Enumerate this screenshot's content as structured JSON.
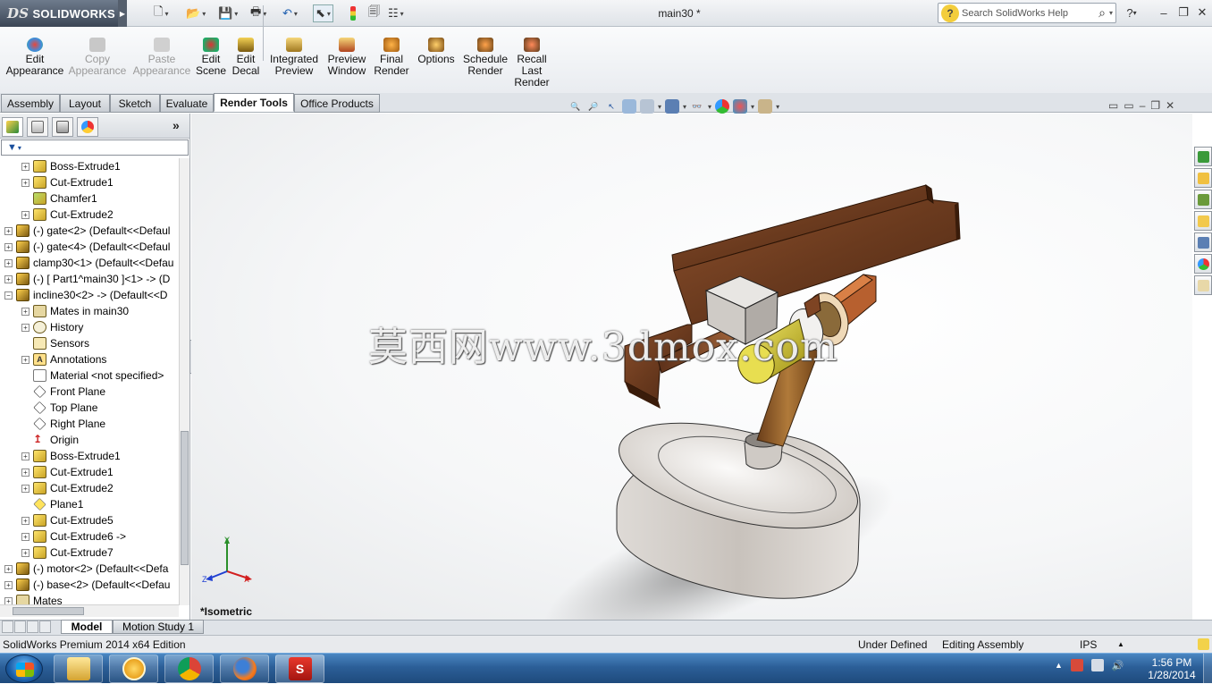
{
  "app": {
    "brand": "SOLIDWORKS",
    "brand_prefix": "DS",
    "document_title": "main30 *"
  },
  "quick_access": [
    {
      "name": "new-icon"
    },
    {
      "name": "open-icon"
    },
    {
      "name": "save-icon"
    },
    {
      "name": "print-icon"
    },
    {
      "name": "undo-icon"
    },
    {
      "name": "select-icon"
    },
    {
      "name": "rebuild-icon"
    },
    {
      "name": "file-properties-icon"
    },
    {
      "name": "options-icon"
    }
  ],
  "search": {
    "placeholder": "Search SolidWorks Help"
  },
  "command_manager": {
    "edit_appearance": "Edit\nAppearance",
    "copy_appearance": "Copy\nAppearance",
    "paste_appearance": "Paste\nAppearance",
    "edit_scene": "Edit\nScene",
    "edit_decal": "Edit\nDecal",
    "integrated_preview": "Integrated\nPreview",
    "preview_window": "Preview\nWindow",
    "final_render": "Final\nRender",
    "options": "Options",
    "schedule_render": "Schedule\nRender",
    "recall_last_render": "Recall\nLast\nRender"
  },
  "tabs": [
    "Assembly",
    "Layout",
    "Sketch",
    "Evaluate",
    "Render Tools",
    "Office Products"
  ],
  "active_tab": "Render Tools",
  "tree": [
    {
      "label": "Boss-Extrude1",
      "indent": 1,
      "icon": "feat",
      "exp": "+"
    },
    {
      "label": "Cut-Extrude1",
      "indent": 1,
      "icon": "feat",
      "exp": "+"
    },
    {
      "label": "Chamfer1",
      "indent": 1,
      "icon": "chamf",
      "exp": ""
    },
    {
      "label": "Cut-Extrude2",
      "indent": 1,
      "icon": "feat",
      "exp": "+"
    },
    {
      "label": "(-) gate<2> (Default<<Defaul",
      "indent": 0,
      "icon": "comp",
      "exp": "+"
    },
    {
      "label": "(-) gate<4> (Default<<Defaul",
      "indent": 0,
      "icon": "comp",
      "exp": "+"
    },
    {
      "label": "clamp30<1> (Default<<Defau",
      "indent": 0,
      "icon": "comp",
      "exp": "+"
    },
    {
      "label": "(-) [ Part1^main30 ]<1> -> (D",
      "indent": 0,
      "icon": "comp",
      "exp": "+"
    },
    {
      "label": "incline30<2> -> (Default<<D",
      "indent": 0,
      "icon": "comp",
      "exp": "−"
    },
    {
      "label": "Mates in main30",
      "indent": 1,
      "icon": "mates",
      "exp": "+"
    },
    {
      "label": "History",
      "indent": 1,
      "icon": "hist",
      "exp": "+"
    },
    {
      "label": "Sensors",
      "indent": 1,
      "icon": "sens",
      "exp": ""
    },
    {
      "label": "Annotations",
      "indent": 1,
      "icon": "ann",
      "exp": "+"
    },
    {
      "label": "Material <not specified>",
      "indent": 1,
      "icon": "mat",
      "exp": ""
    },
    {
      "label": "Front Plane",
      "indent": 1,
      "icon": "plane",
      "exp": ""
    },
    {
      "label": "Top Plane",
      "indent": 1,
      "icon": "plane",
      "exp": ""
    },
    {
      "label": "Right Plane",
      "indent": 1,
      "icon": "plane",
      "exp": ""
    },
    {
      "label": "Origin",
      "indent": 1,
      "icon": "origin",
      "exp": ""
    },
    {
      "label": "Boss-Extrude1",
      "indent": 1,
      "icon": "feat",
      "exp": "+"
    },
    {
      "label": "Cut-Extrude1",
      "indent": 1,
      "icon": "feat",
      "exp": "+"
    },
    {
      "label": "Cut-Extrude2",
      "indent": 1,
      "icon": "feat",
      "exp": "+"
    },
    {
      "label": "Plane1",
      "indent": 1,
      "icon": "plane1",
      "exp": ""
    },
    {
      "label": "Cut-Extrude5",
      "indent": 1,
      "icon": "feat",
      "exp": "+"
    },
    {
      "label": "Cut-Extrude6 ->",
      "indent": 1,
      "icon": "feat",
      "exp": "+"
    },
    {
      "label": "Cut-Extrude7",
      "indent": 1,
      "icon": "feat",
      "exp": "+"
    },
    {
      "label": "(-) motor<2> (Default<<Defa",
      "indent": 0,
      "icon": "comp",
      "exp": "+"
    },
    {
      "label": "(-) base<2> (Default<<Defau",
      "indent": 0,
      "icon": "comp",
      "exp": "+"
    },
    {
      "label": "Mates",
      "indent": 0,
      "icon": "mates",
      "exp": "+"
    }
  ],
  "viewport": {
    "view_name": "*Isometric",
    "watermark": "莫西网www.3dmox.com",
    "triad": {
      "x": "X",
      "y": "Y",
      "z": "Z"
    }
  },
  "bottom_tabs": [
    "Model",
    "Motion Study 1"
  ],
  "status": {
    "edition": "SolidWorks Premium 2014 x64 Edition",
    "state": "Under Defined",
    "mode": "Editing Assembly",
    "units": "IPS"
  },
  "taskbar": {
    "time": "1:56 PM",
    "date": "1/28/2014",
    "apps": [
      "explorer",
      "media-player",
      "chrome",
      "firefox",
      "solidworks"
    ]
  },
  "colors": {
    "accent": "#2c5f98",
    "wood": "#7a4425",
    "motor": "#d8cc2e",
    "base": "#dcd7d2"
  }
}
